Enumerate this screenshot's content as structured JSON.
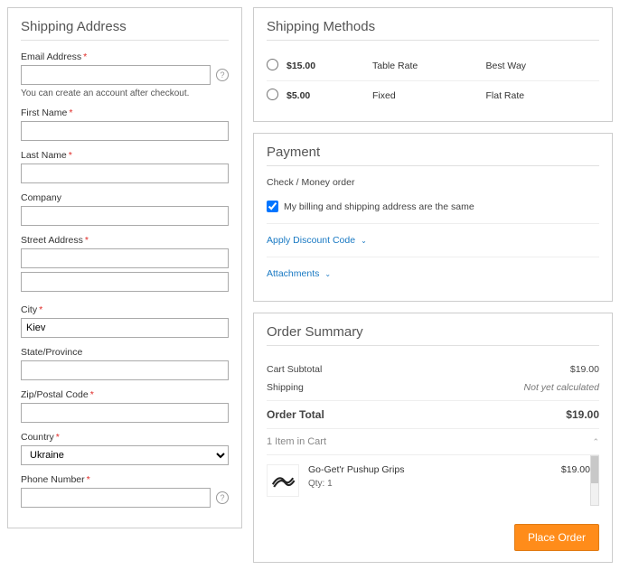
{
  "shipping_address": {
    "title": "Shipping Address",
    "email_label": "Email Address",
    "email_note": "You can create an account after checkout.",
    "first_name_label": "First Name",
    "last_name_label": "Last Name",
    "company_label": "Company",
    "street_label": "Street Address",
    "city_label": "City",
    "city_value": "Kiev",
    "state_label": "State/Province",
    "zip_label": "Zip/Postal Code",
    "country_label": "Country",
    "country_value": "Ukraine",
    "phone_label": "Phone Number"
  },
  "shipping_methods": {
    "title": "Shipping Methods",
    "rows": [
      {
        "price": "$15.00",
        "method": "Table Rate",
        "carrier": "Best Way"
      },
      {
        "price": "$5.00",
        "method": "Fixed",
        "carrier": "Flat Rate"
      }
    ]
  },
  "payment": {
    "title": "Payment",
    "method_label": "Check / Money order",
    "same_address_label": "My billing and shipping address are the same",
    "discount_link": "Apply Discount Code",
    "attachments_link": "Attachments"
  },
  "summary": {
    "title": "Order Summary",
    "subtotal_label": "Cart Subtotal",
    "subtotal_value": "$19.00",
    "shipping_label": "Shipping",
    "shipping_value": "Not yet calculated",
    "total_label": "Order Total",
    "total_value": "$19.00",
    "cart_count_label": "1 Item in Cart",
    "item": {
      "name": "Go-Get'r Pushup Grips",
      "qty_label": "Qty: 1",
      "price": "$19.00"
    },
    "place_order_label": "Place Order"
  }
}
